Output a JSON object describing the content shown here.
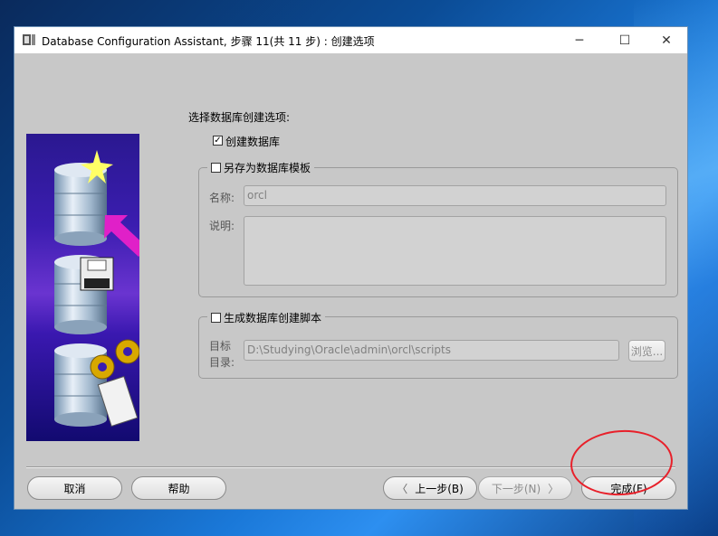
{
  "window": {
    "title": "Database Configuration Assistant, 步骤 11(共 11 步) : 创建选项",
    "controls": {
      "minimize": "─",
      "maximize": "☐",
      "close": "✕"
    }
  },
  "main": {
    "heading": "选择数据库创建选项:",
    "create_db": {
      "label": "创建数据库",
      "checked": true
    },
    "template_group": {
      "label": "另存为数据库模板",
      "checked": false,
      "name_label": "名称:",
      "name_value": "orcl",
      "desc_label": "说明:",
      "desc_value": ""
    },
    "script_group": {
      "label": "生成数据库创建脚本",
      "checked": false,
      "dest_label_1": "目标",
      "dest_label_2": "目录:",
      "dest_value": "D:\\Studying\\Oracle\\admin\\orcl\\scripts",
      "browse_label": "浏览..."
    }
  },
  "footer": {
    "cancel": "取消",
    "help": "帮助",
    "back": "上一步(B)",
    "next": "下一步(N)",
    "finish": "完成(F)"
  },
  "colors": {
    "annotation_circle": "#e8202a",
    "window_bg": "#c8c8c8"
  }
}
